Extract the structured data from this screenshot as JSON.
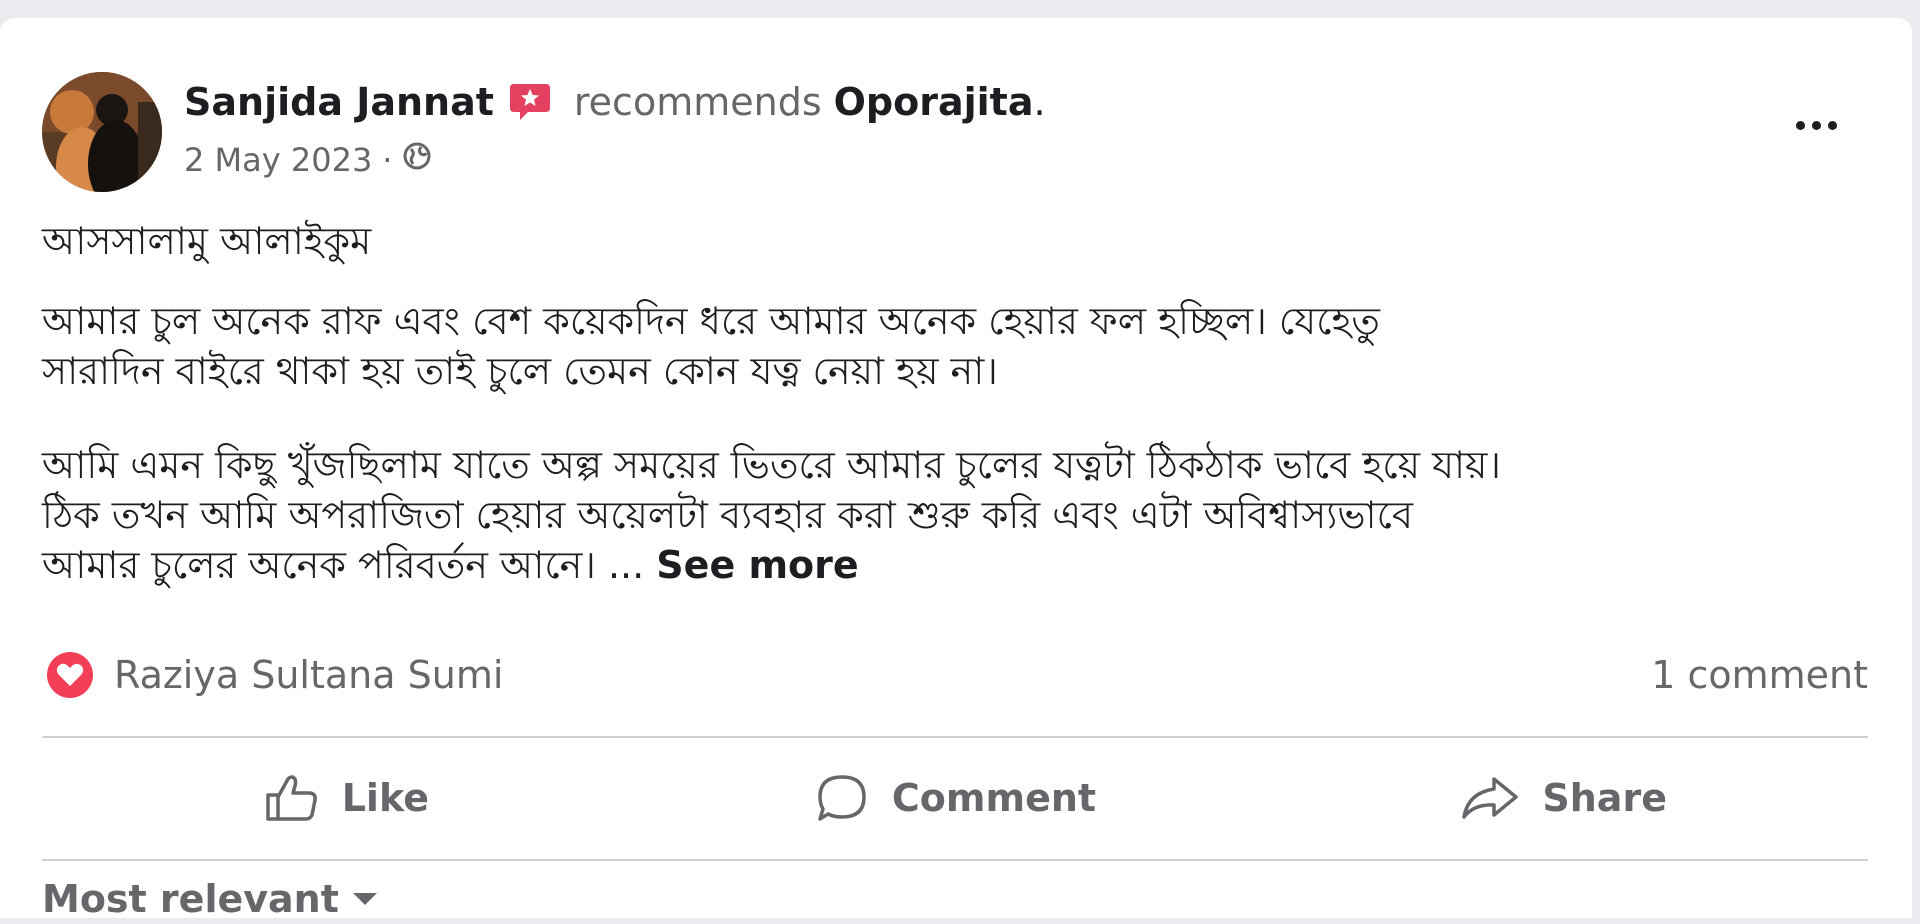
{
  "post": {
    "author": "Sanjida Jannat",
    "recommends_text": "recommends",
    "page_name": "Oporajita",
    "period": ".",
    "date": "2 May 2023",
    "dot": "·",
    "paragraphs": [
      "আসসালামু আলাইকুম",
      "আমার চুল অনেক রাফ এবং বেশ কয়েকদিন ধরে আমার অনেক হেয়ার ফল হচ্ছিল। যেহেতু",
      "সারাদিন বাইরে থাকা হয় তাই চুলে তেমন কোন যত্ন নেয়া হয় না।",
      "আমি এমন কিছু খুঁজছিলাম যাতে অল্প সময়ের ভিতরে আমার চুলের যত্নটা ঠিকঠাক ভাবে হয়ে যায়।",
      "ঠিক তখন আমি অপরাজিতা হেয়ার অয়েলটা ব্যবহার করা শুরু করি এবং এটা অবিশ্বাস্যভাবে",
      "আমার চুলের অনেক পরিবর্তন আনে। ..."
    ],
    "see_more": "See more"
  },
  "reactions": {
    "reactor_name": "Raziya Sultana Sumi",
    "icon": "love-reaction-icon",
    "comment_count": "1 comment"
  },
  "actions": {
    "like": "Like",
    "comment": "Comment",
    "share": "Share"
  },
  "comments": {
    "sort_label": "Most relevant"
  },
  "colors": {
    "text_primary": "#1c1e21",
    "text_secondary": "#65676b",
    "love_red": "#f33e58",
    "badge_red": "#e4405f",
    "divider": "#ced0d4",
    "background": "#e9ebee"
  }
}
